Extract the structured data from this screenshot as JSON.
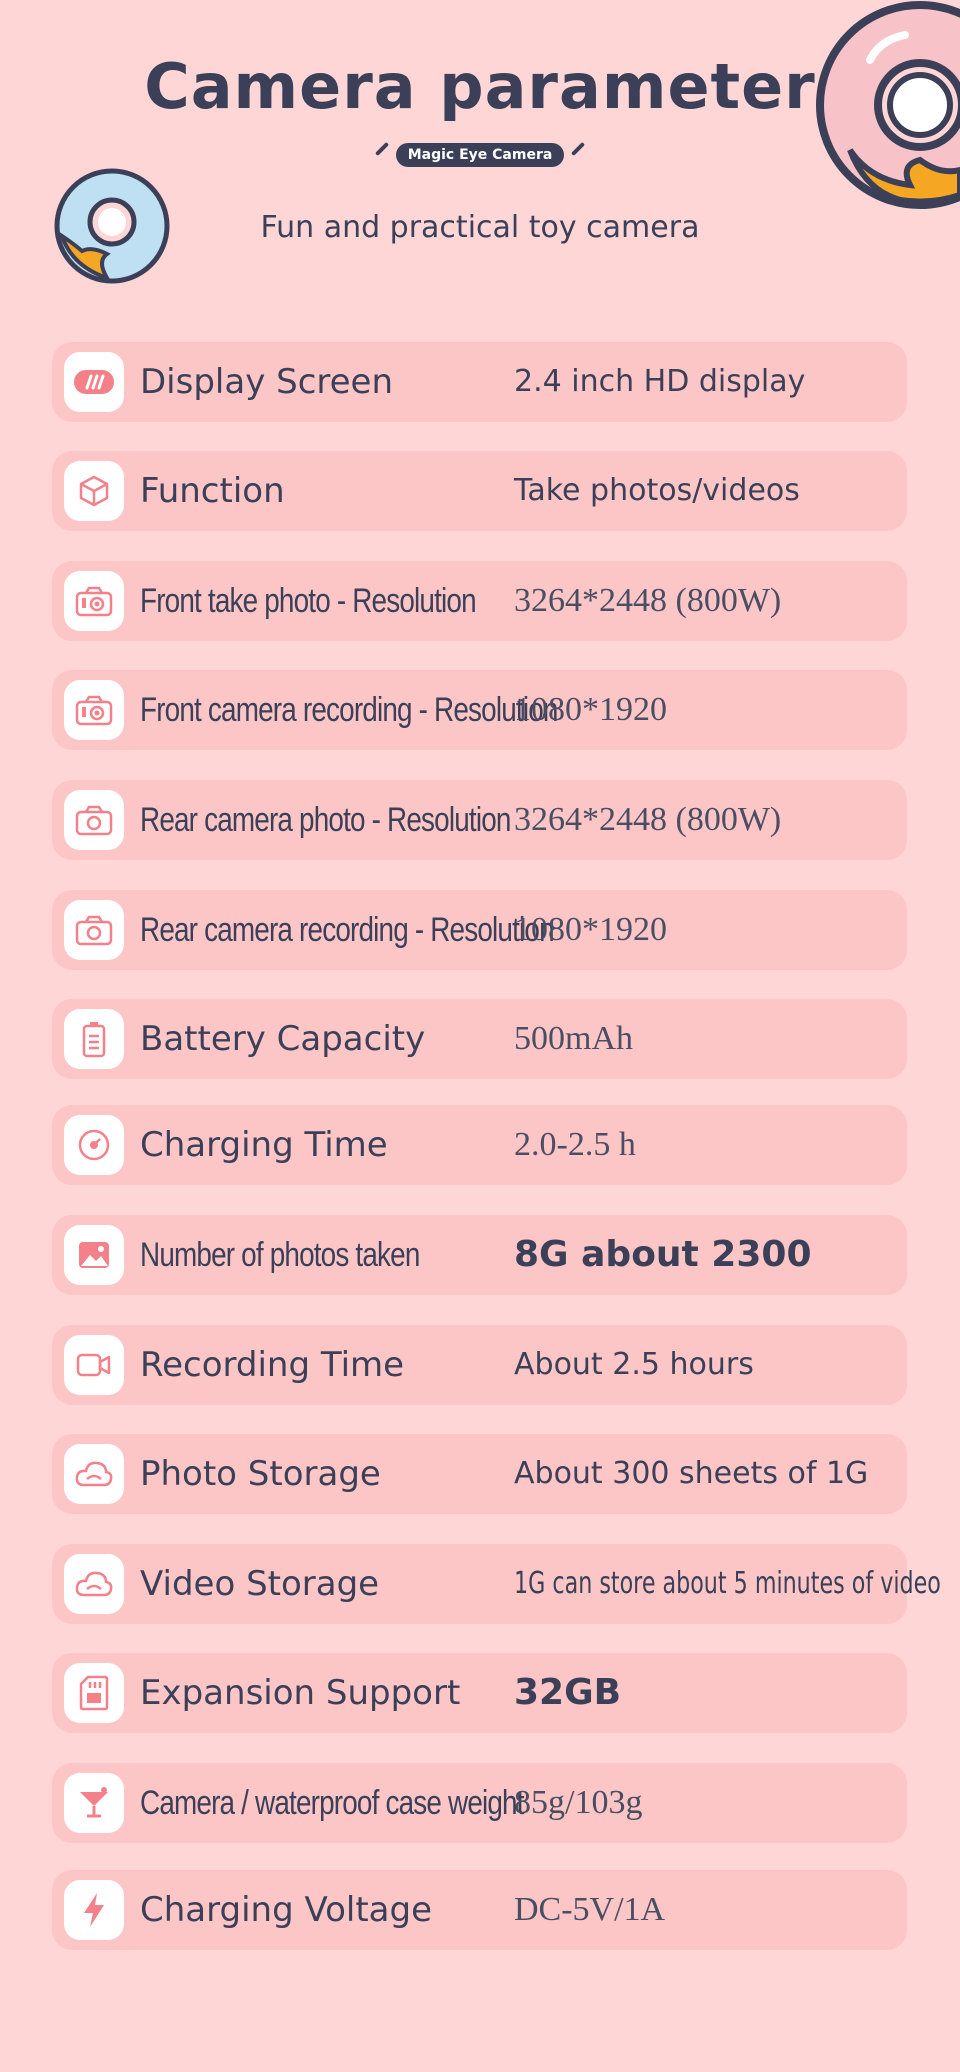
{
  "header": {
    "title": "Camera parameter",
    "badge": "Magic Eye Camera",
    "subtitle": "Fun and practical toy camera"
  },
  "colors": {
    "background": "#fed6d6",
    "row": "#fdc6c6",
    "text": "#3b4058",
    "icon": "#f4808a"
  },
  "rows": [
    {
      "label": "Display Screen",
      "value": "2.4 inch HD display",
      "icon": "display-icon"
    },
    {
      "label": "Function",
      "value": "Take photos/videos",
      "icon": "cube-icon"
    },
    {
      "label": "Front take photo - Resolution",
      "value": "3264*2448 (800W)",
      "icon": "camera-icon"
    },
    {
      "label": "Front camera recording - Resolution",
      "value": "1080*1920",
      "icon": "camera-icon"
    },
    {
      "label": "Rear camera photo - Resolution",
      "value": "3264*2448 (800W)",
      "icon": "camera-icon"
    },
    {
      "label": "Rear camera recording - Resolution",
      "value": "1080*1920",
      "icon": "camera-icon"
    },
    {
      "label": "Battery Capacity",
      "value": "500mAh",
      "icon": "battery-icon"
    },
    {
      "label": "Charging Time",
      "value": "2.0-2.5 h",
      "icon": "clock-icon"
    },
    {
      "label": "Number of photos taken",
      "value": "8G about 2300",
      "icon": "image-icon"
    },
    {
      "label": "Recording Time",
      "value": "About 2.5 hours",
      "icon": "video-icon"
    },
    {
      "label": "Photo Storage",
      "value": "About 300 sheets of 1G",
      "icon": "cloud-icon"
    },
    {
      "label": "Video Storage",
      "value": "1G can store about 5 minutes of video",
      "icon": "cloud-icon"
    },
    {
      "label": "Expansion Support",
      "value": "32GB",
      "icon": "sd-card-icon"
    },
    {
      "label": "Camera / waterproof case weight",
      "value": "85g/103g",
      "icon": "scale-icon"
    },
    {
      "label": "Charging Voltage",
      "value": "DC-5V/1A",
      "icon": "lightning-icon"
    }
  ]
}
